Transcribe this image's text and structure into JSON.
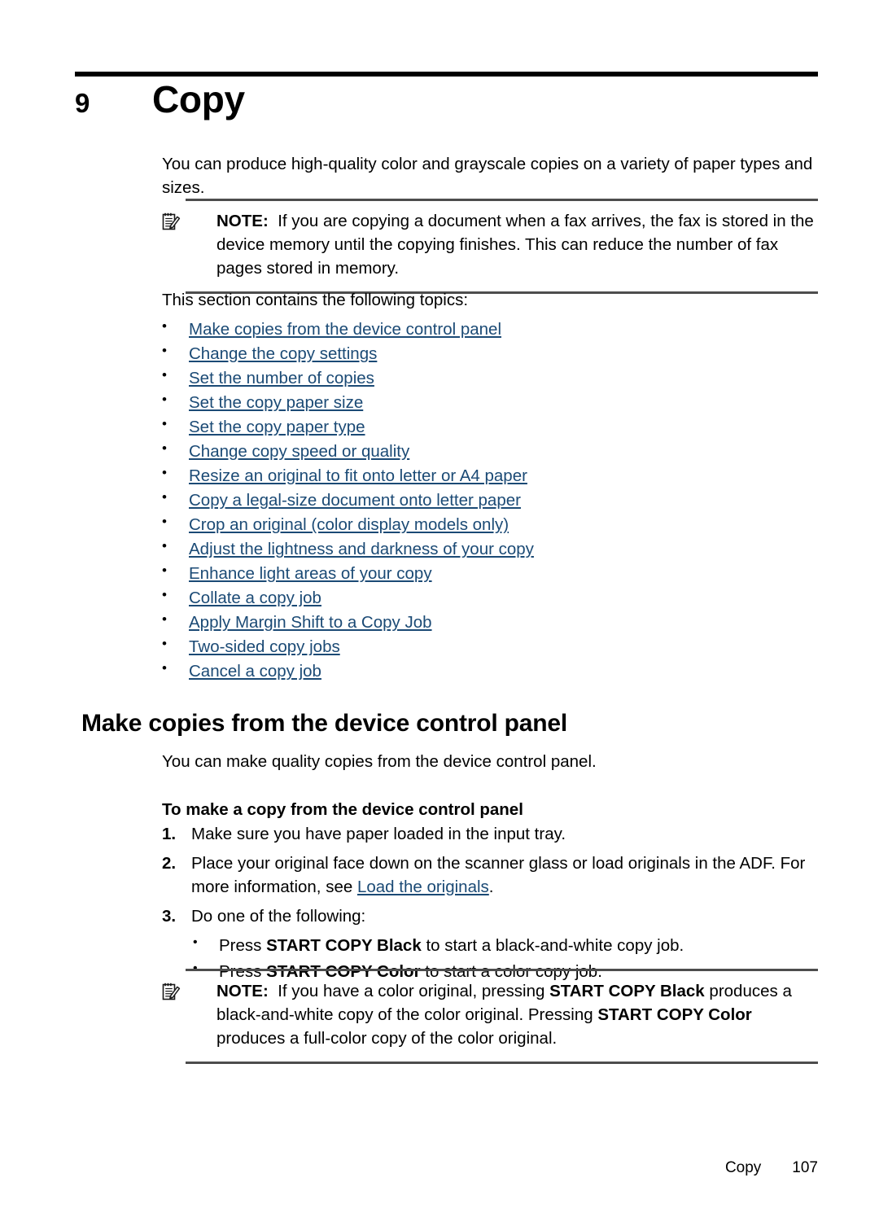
{
  "chapter": {
    "number": "9",
    "title": "Copy"
  },
  "intro": {
    "paragraph": "You can produce high-quality color and grayscale copies on a variety of paper types and sizes."
  },
  "note_top": {
    "icon": "note-pad-pencil-icon",
    "label": "NOTE:",
    "text": "If you are copying a document when a fax arrives, the fax is stored in the device memory until the copying finishes. This can reduce the number of fax pages stored in memory."
  },
  "topics": {
    "lead_in": "This section contains the following topics:",
    "links": [
      "Make copies from the device control panel",
      "Change the copy settings",
      "Set the number of copies",
      "Set the copy paper size",
      "Set the copy paper type",
      "Change copy speed or quality",
      "Resize an original to fit onto letter or A4 paper",
      "Copy a legal-size document onto letter paper",
      "Crop an original (color display models only)",
      "Adjust the lightness and darkness of your copy",
      "Enhance light areas of your copy",
      "Collate a copy job",
      "Apply Margin Shift to a Copy Job",
      "Two-sided copy jobs",
      "Cancel a copy job"
    ]
  },
  "section": {
    "heading": "Make copies from the device control panel",
    "paragraph": "You can make quality copies from the device control panel.",
    "procedure_heading": "To make a copy from the device control panel"
  },
  "steps": {
    "step1": {
      "number": "1.",
      "text": "Make sure you have paper loaded in the input tray."
    },
    "step2": {
      "number": "2.",
      "text_before": "Place your original face down on the scanner glass or load originals in the ADF. For more information, see ",
      "link": "Load the originals",
      "text_after": "."
    },
    "step3": {
      "number": "3.",
      "text": "Do one of the following:",
      "substeps": [
        {
          "prefix": "Press ",
          "bold": "START COPY Black",
          "suffix": " to start a black-and-white copy job."
        },
        {
          "prefix": "Press ",
          "bold": "START COPY Color",
          "suffix": " to start a color copy job."
        }
      ]
    }
  },
  "note_bottom": {
    "icon": "note-pad-pencil-icon",
    "label": "NOTE:",
    "part1": "If you have a color original, pressing ",
    "bold1": "START COPY Black",
    "part2": " produces a black-and-white copy of the color original. Pressing ",
    "bold2": "START COPY Color",
    "part3": " produces a full-color copy of the color original."
  },
  "footer": {
    "label": "Copy",
    "page_number": "107"
  },
  "colors": {
    "link": "#1b4a75",
    "rule": "#4d4d4d",
    "text": "#000000"
  }
}
